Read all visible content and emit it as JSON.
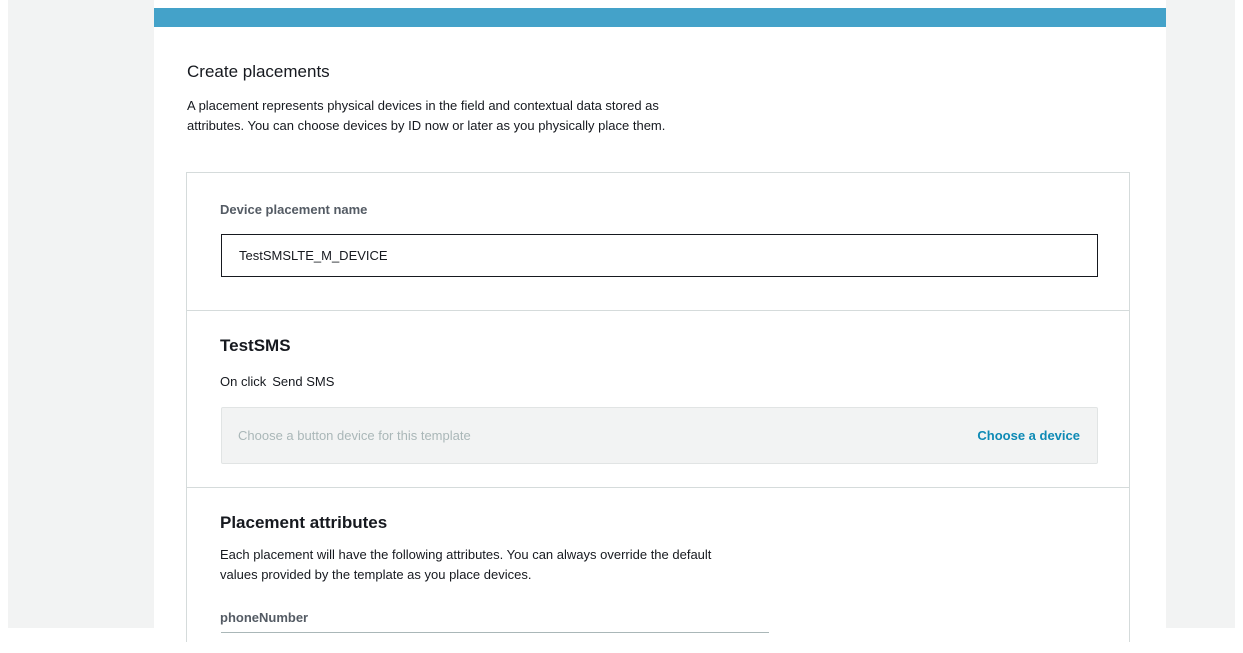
{
  "create_placements": {
    "title": "Create placements",
    "description_line1": "A placement represents physical devices in the field and contextual data stored as",
    "description_line2": "attributes. You can choose devices by ID now or later as you physically place them."
  },
  "device_placement": {
    "label": "Device placement name",
    "value": "TestSMSLTE_M_DEVICE"
  },
  "template": {
    "name": "TestSMS",
    "trigger": "On click",
    "action": "Send SMS",
    "device_placeholder": "Choose a button device for this template",
    "choose_device_label": "Choose a device"
  },
  "placement_attributes": {
    "title": "Placement attributes",
    "description_line1": "Each placement will have the following attributes. You can always override the default",
    "description_line2": "values provided by the template as you place devices.",
    "attributes": [
      {
        "name": "phoneNumber"
      }
    ]
  },
  "colors": {
    "accent_bar": "#44a2c9",
    "link": "#0e8ab5",
    "page_background": "#f2f3f3"
  }
}
